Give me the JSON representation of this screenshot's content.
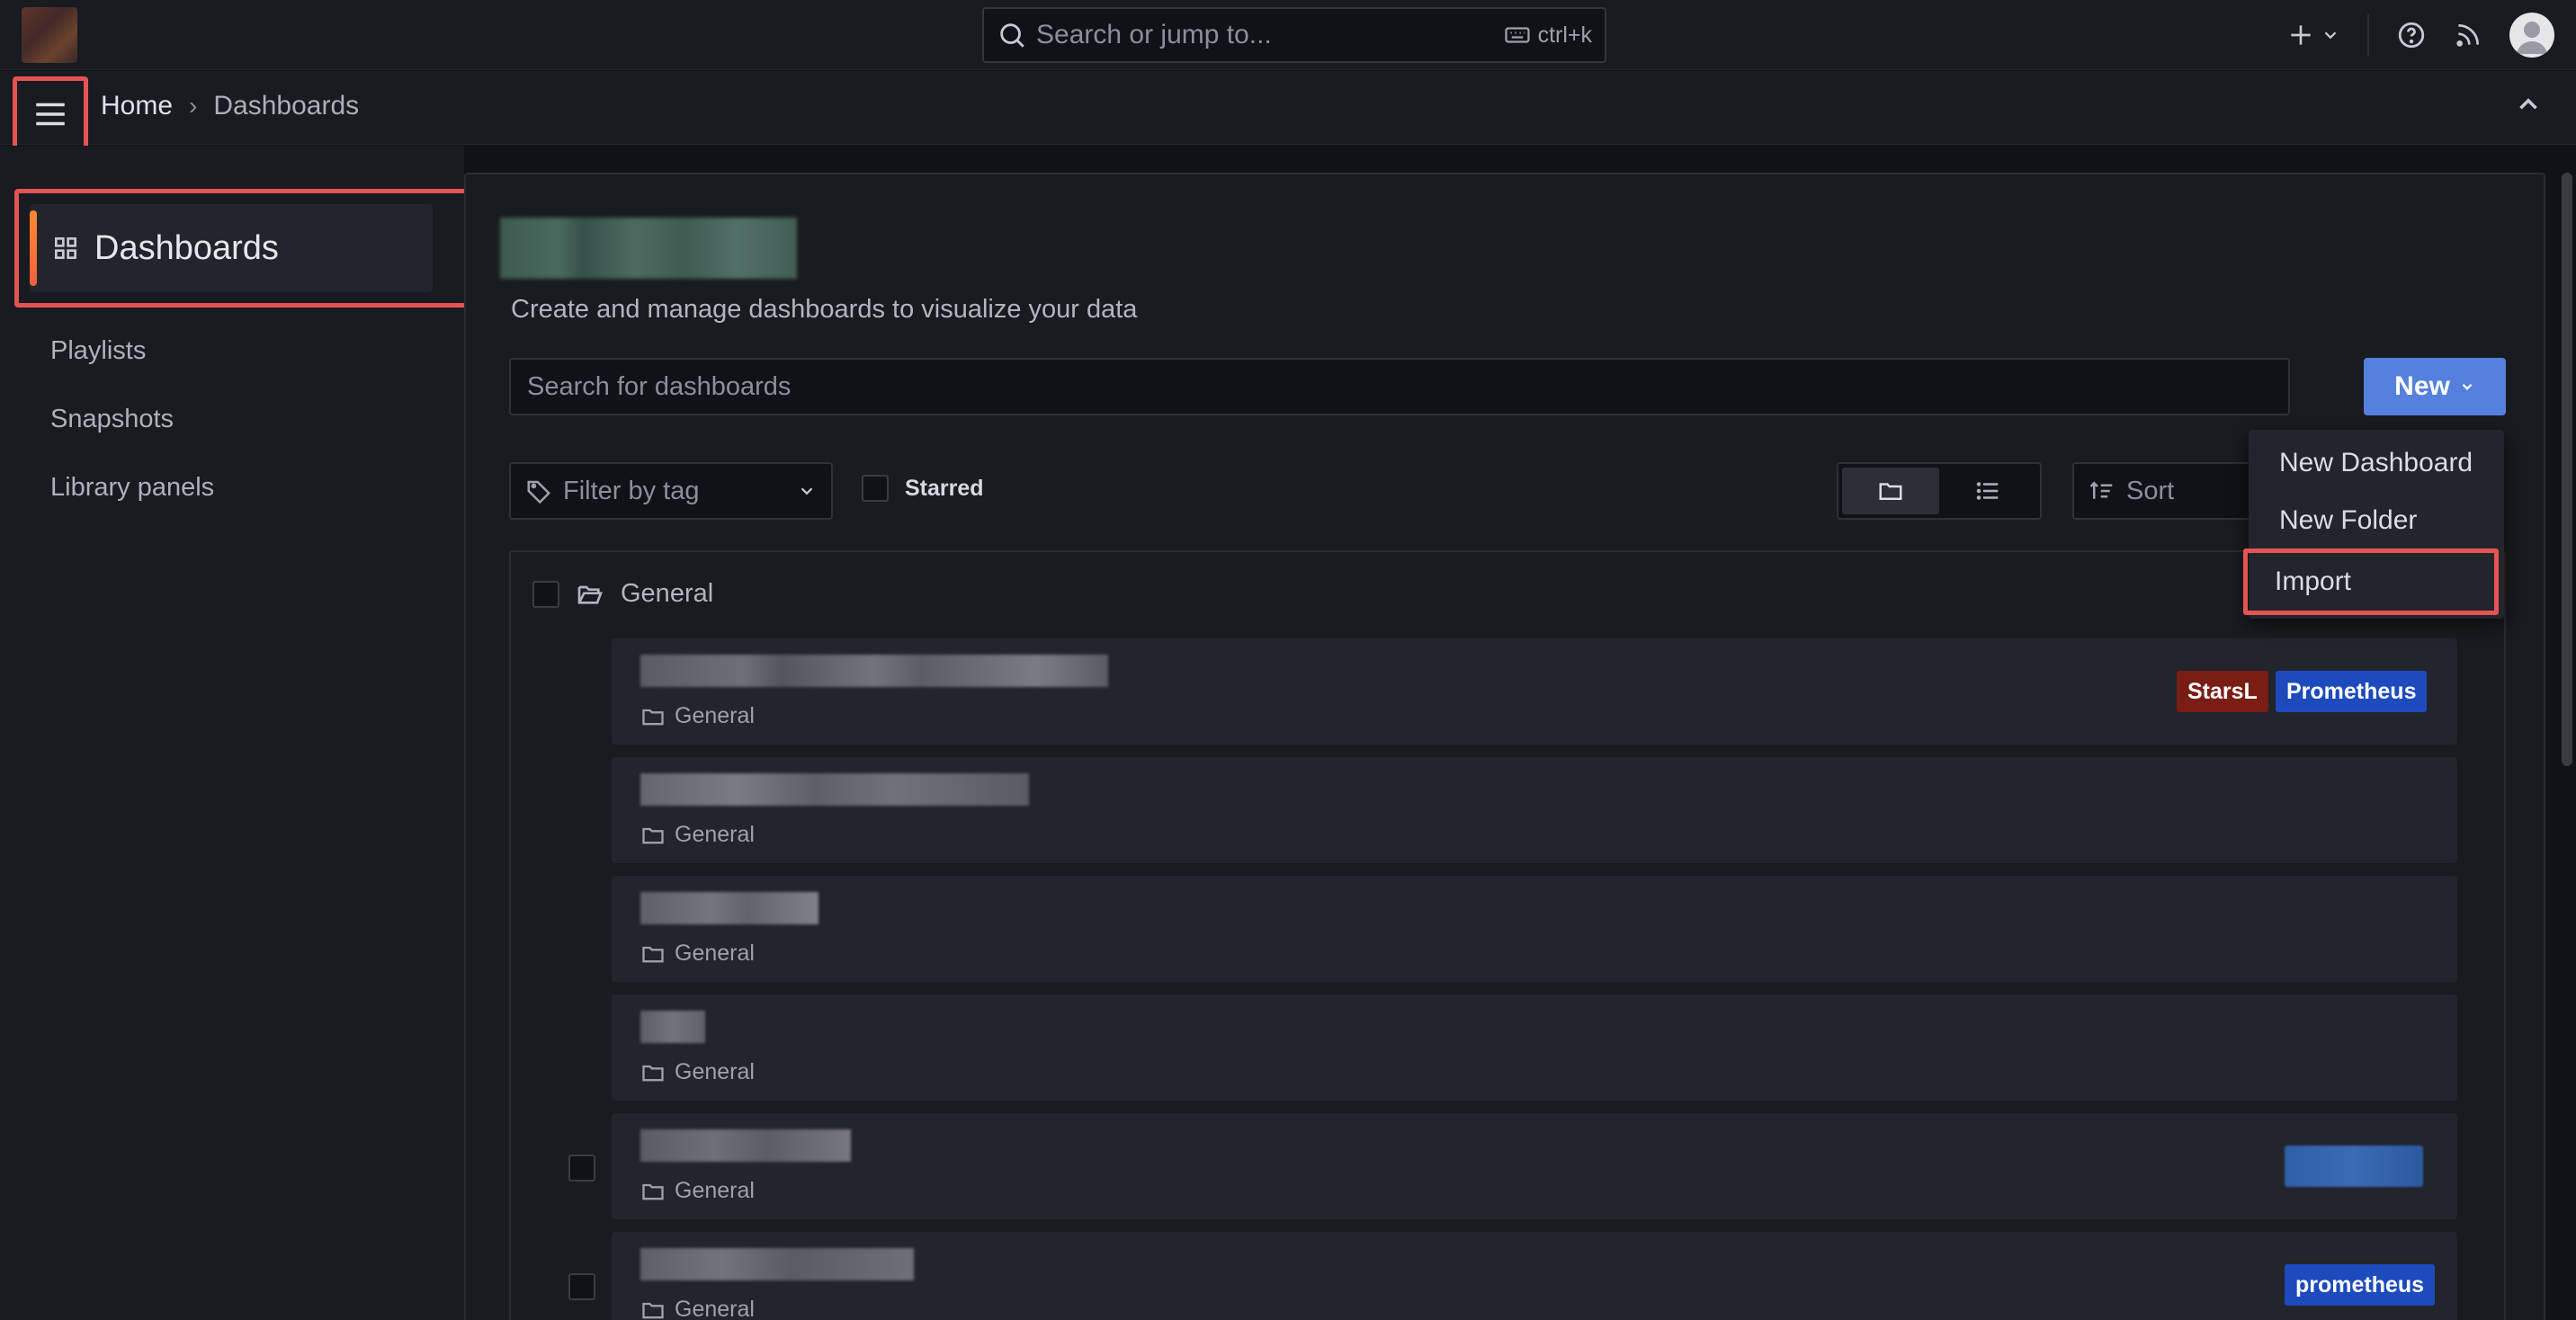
{
  "topbar": {
    "search_placeholder": "Search or jump to...",
    "shortcut": "ctrl+k"
  },
  "breadcrumb": {
    "home": "Home",
    "separator": "›",
    "current": "Dashboards"
  },
  "sidebar": {
    "active": "Dashboards",
    "items": [
      "Playlists",
      "Snapshots",
      "Library panels"
    ]
  },
  "main": {
    "subtitle": "Create and manage dashboards to visualize your data",
    "search_placeholder": "Search for dashboards",
    "new_button": "New",
    "filter_placeholder": "Filter by tag",
    "starred_label": "Starred",
    "sort_label": "Sort",
    "folder": "General"
  },
  "dashboards": [
    {
      "folder": "General",
      "tags": [
        "StarsL",
        "Prometheus"
      ]
    },
    {
      "folder": "General",
      "tags": []
    },
    {
      "folder": "General",
      "tags": []
    },
    {
      "folder": "General",
      "tags": []
    },
    {
      "folder": "General",
      "tags": []
    },
    {
      "folder": "General",
      "tags": [
        "prometheus"
      ]
    }
  ],
  "dropdown": {
    "items": [
      "New Dashboard",
      "New Folder",
      "Import"
    ]
  },
  "colors": {
    "accent_blue": "#5580dd",
    "highlight_red": "#e55353",
    "tag_red": "#7a1d15",
    "tag_blue": "#1d4bbd"
  }
}
